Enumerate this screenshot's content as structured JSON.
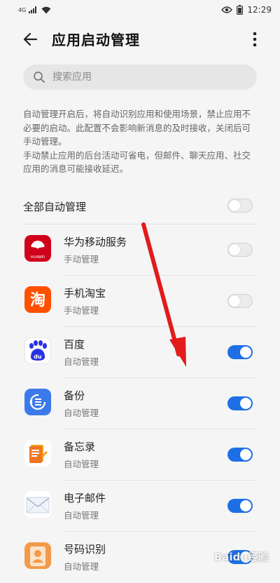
{
  "status_bar": {
    "network": "4G",
    "time": "12:29"
  },
  "header": {
    "title": "应用启动管理",
    "back_icon": "arrow-left-icon",
    "more_icon": "more-vertical-icon"
  },
  "search": {
    "placeholder": "搜索应用",
    "icon": "search-icon"
  },
  "description": {
    "paragraph1": "自动管理开启后，将自动识别应用和使用场景，禁止应用不必要的启动。此配置不会影响新消息的及时接收，关闭后可手动管理。",
    "paragraph2": "手动禁止应用的后台活动可省电，但邮件、聊天应用、社交应用的消息可能接收延迟。"
  },
  "auto_manage_all": {
    "label": "全部自动管理",
    "enabled": false
  },
  "apps": [
    {
      "name": "华为移动服务",
      "status": "手动管理",
      "enabled": false,
      "icon": "huawei-icon",
      "icon_caption": "HUAWEI"
    },
    {
      "name": "手机淘宝",
      "status": "手动管理",
      "enabled": false,
      "icon": "taobao-icon",
      "icon_glyph": "淘"
    },
    {
      "name": "百度",
      "status": "自动管理",
      "enabled": true,
      "icon": "baidu-paw-icon",
      "icon_caption": "du"
    },
    {
      "name": "备份",
      "status": "自动管理",
      "enabled": true,
      "icon": "backup-icon"
    },
    {
      "name": "备忘录",
      "status": "自动管理",
      "enabled": true,
      "icon": "memo-icon"
    },
    {
      "name": "电子邮件",
      "status": "自动管理",
      "enabled": true,
      "icon": "email-icon"
    },
    {
      "name": "号码识别",
      "status": "自动管理",
      "enabled": true,
      "icon": "contact-id-icon"
    }
  ],
  "colors": {
    "accent": "#1e6fe6",
    "annotation_arrow": "#e21b1b"
  },
  "watermark": "Baidu经验"
}
